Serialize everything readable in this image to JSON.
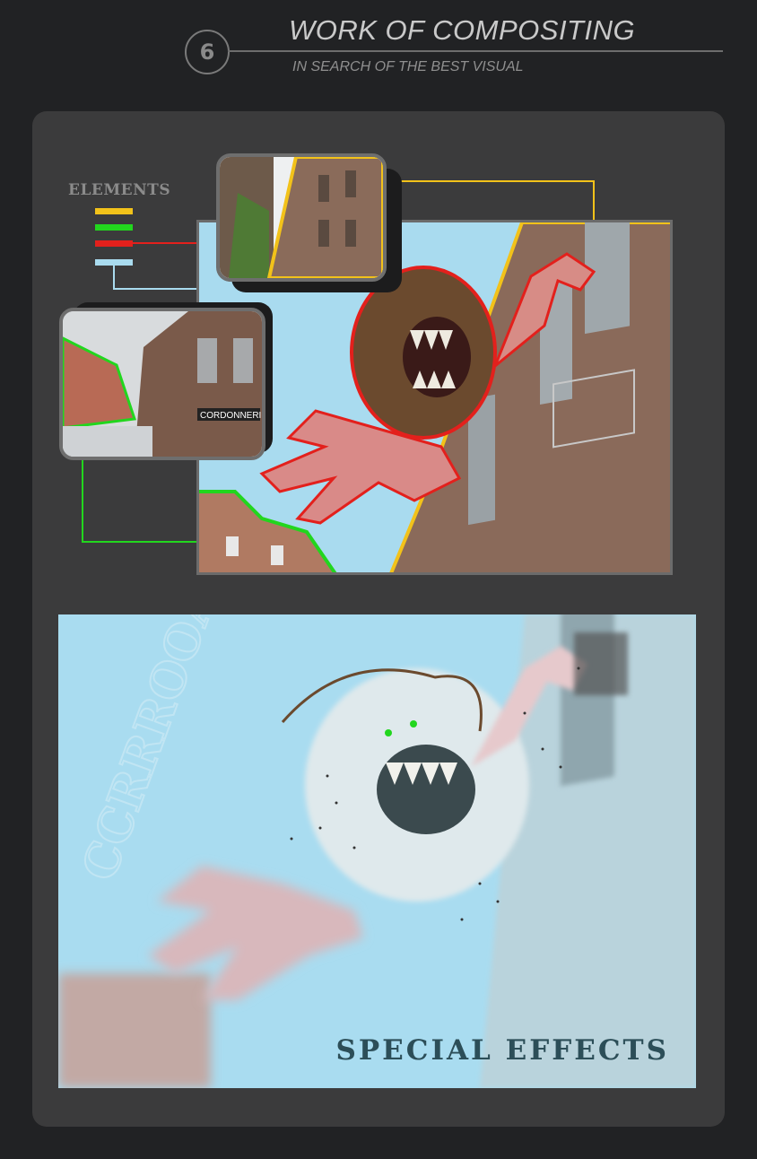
{
  "header": {
    "step_number": "6",
    "title": "WORK OF COMPOSITING",
    "subtitle": "IN SEARCH OF THE BEST VISUAL"
  },
  "legend": {
    "title": "ELEMENTS",
    "colors": {
      "yellow": "#f2c21a",
      "green": "#22d61e",
      "red": "#e3201c",
      "light_blue": "#a9dbef"
    }
  },
  "thumbnails": {
    "street_shop_sign": "CORDONNERIE"
  },
  "effects": {
    "label": "SPECIAL EFFECTS",
    "sound_effect": "CCRRROOAAA"
  }
}
